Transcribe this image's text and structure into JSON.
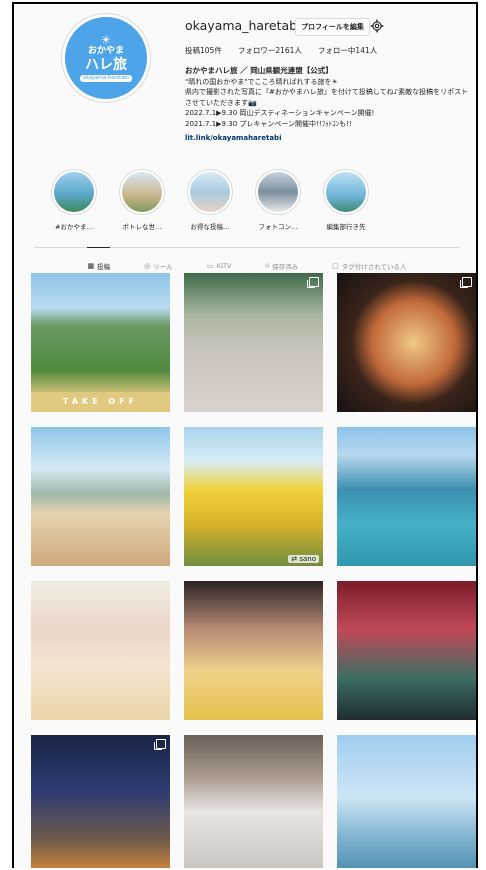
{
  "profile": {
    "username": "okayama_haretabi",
    "edit_button": "プロフィールを編集",
    "avatar": {
      "l1": "おかやま",
      "l2": "ハレ旅",
      "l3": "okayama-haretabi"
    },
    "stats": {
      "posts": "投稿105件",
      "followers": "フォロワー2161人",
      "following": "フォロー中141人"
    },
    "bio": {
      "name": "おかやまハレ旅 ／ 岡山県観光連盟【公式】",
      "lines": [
        "\"晴れの国おかやま\"でこころ晴ればれする旅を☀",
        "県内で撮影された写真に『#おかやまハレ旅』を付けて投稿してね♪素敵な投稿をリポストさせていただきます📷",
        "2022.7.1▶9.30 岡山デスティネーションキャンペーン開催!",
        "2021.7.1▶9.30 プレキャンペーン開催中!!ﾌｫﾄｺﾝも!!"
      ],
      "link": "lit.link/okayamaharetabi"
    }
  },
  "highlights": [
    {
      "label": "#おかやま…",
      "color": "#5aa7c9"
    },
    {
      "label": "ポトレな世…",
      "color": "#c9b38a"
    },
    {
      "label": "お得な投稿…",
      "color": "#a9cbe0"
    },
    {
      "label": "フォトコン…",
      "color": "#7d8f9c"
    },
    {
      "label": "編集部行き先",
      "color": "#6db3d8"
    }
  ],
  "tabs": [
    {
      "label": "投稿",
      "icon": "grid-icon",
      "active": true
    },
    {
      "label": "リール",
      "icon": "reel-icon",
      "active": false
    },
    {
      "label": "IGTV",
      "icon": "tv-icon",
      "active": false
    },
    {
      "label": "保存済み",
      "icon": "bookmark-icon",
      "active": false
    },
    {
      "label": "タグ付けされている人",
      "icon": "tag-icon",
      "active": false
    }
  ],
  "posts": [
    {
      "bg": "linear-gradient(180deg,#8fc4e8 0%,#b9dbf0 25%,#6a9a63 38%,#4f8a3e 70%,#d9c37a 88%,#e7ecf1 100%)",
      "multi": false,
      "text": "TAKE  OFF"
    },
    {
      "bg": "linear-gradient(180deg,#3f6a4a 0%,#a8b7a0 30%,#c9c4bb 55%,#d8d3cc 100%)",
      "multi": true
    },
    {
      "bg": "radial-gradient(circle at 55% 50%,#f0c985 0%,#c26a3a 40%,#3a241a 60%,#151211 100%)",
      "multi": true
    },
    {
      "bg": "linear-gradient(180deg,#8ec6ea 0%,#d7ebf7 30%,#9fb7a6 48%,#e6d3b1 62%,#cfa97a 100%)",
      "multi": false
    },
    {
      "bg": "linear-gradient(180deg,#a8d3ee 0%,#d9ecf4 25%,#f1d33b 45%,#d7b22a 70%,#6f8d3d 100%)",
      "multi": false,
      "tag": "sano"
    },
    {
      "bg": "linear-gradient(180deg,#8cc3ea 0%,#b7d8ef 20%,#3d8fb0 45%,#46b0c8 70%,#2f98ad 100%)",
      "multi": false
    },
    {
      "bg": "linear-gradient(180deg,#f1ece4 0%,#e9d6c8 35%,#f3e5d0 60%,#ecd5a8 100%)",
      "multi": false
    },
    {
      "bg": "linear-gradient(180deg,#2a2323 0%,#b98c75 35%,#f0d08a 65%,#e6c24a 100%)",
      "multi": false
    },
    {
      "bg": "linear-gradient(180deg,#7a1c2a 0%,#c24a58 35%,#3b6d62 70%,#202d33 100%)",
      "multi": false
    },
    {
      "bg": "linear-gradient(180deg,#1b2346 0%,#2d3c73 40%,#6e5a4b 75%,#d88a3a 100%)",
      "multi": true
    },
    {
      "bg": "linear-gradient(180deg,#6a6057 0%,#a99b8f 30%,#e8e4df 55%,#c9c3bd 100%)",
      "multi": false
    },
    {
      "bg": "linear-gradient(180deg,#9fcdef 0%,#cde6f5 45%,#88b9d4 70%,#4c8cad 100%)",
      "multi": false
    }
  ]
}
